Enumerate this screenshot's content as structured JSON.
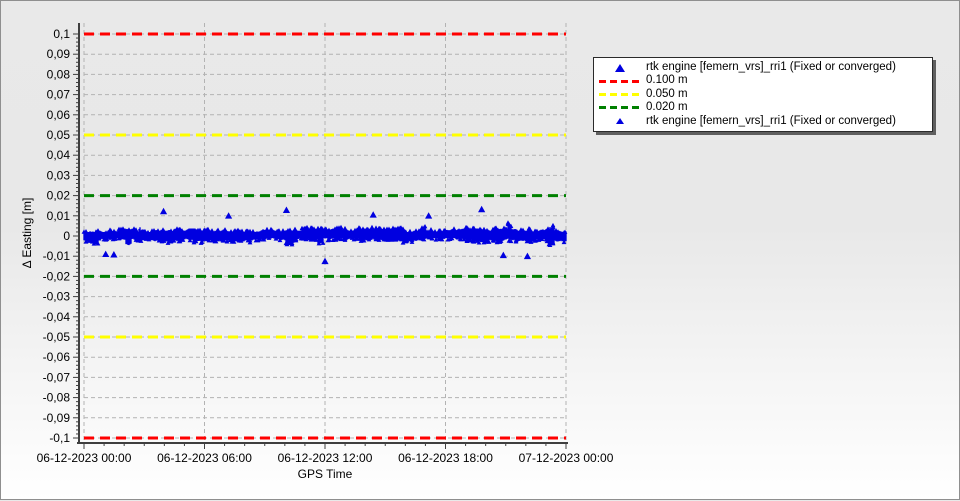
{
  "chart_data": {
    "type": "scatter",
    "title": "",
    "xlabel": "GPS Time",
    "ylabel": "Δ Easting [m]",
    "x_tick_labels": [
      "06-12-2023 00:00",
      "06-12-2023 06:00",
      "06-12-2023 12:00",
      "06-12-2023 18:00",
      "07-12-2023 00:00"
    ],
    "y_tick_labels": [
      "0,1",
      "0,09",
      "0,08",
      "0,07",
      "0,06",
      "0,05",
      "0,04",
      "0,03",
      "0,02",
      "0,01",
      "0",
      "-0,01",
      "-0,02",
      "-0,03",
      "-0,04",
      "-0,05",
      "-0,06",
      "-0,07",
      "-0,08",
      "-0,09",
      "-0,1"
    ],
    "ylim": [
      -0.1,
      0.1
    ],
    "y_major_step": 0.01,
    "decimal_separator": ",",
    "grid": {
      "show": true,
      "color": "#b3b3b3",
      "style": "dashed"
    },
    "axis_color": "#3f3f3f",
    "text_color": "#000000",
    "threshold_lines": [
      {
        "value": 0.1,
        "color": "#ff0000",
        "style": "dashed",
        "label": "0.100 m"
      },
      {
        "value": -0.1,
        "color": "#ff0000",
        "style": "dashed",
        "label": "0.100 m"
      },
      {
        "value": 0.05,
        "color": "#ffff00",
        "style": "dashed",
        "label": "0.050 m"
      },
      {
        "value": -0.05,
        "color": "#ffff00",
        "style": "dashed",
        "label": "0.050 m"
      },
      {
        "value": 0.02,
        "color": "#008000",
        "style": "dashed",
        "label": "0.020 m"
      },
      {
        "value": -0.02,
        "color": "#008000",
        "style": "dashed",
        "label": "0.020 m"
      }
    ],
    "series": [
      {
        "name": "rtk engine [femern_vrs]_rri1 (Fixed or converged)",
        "marker": "triangle",
        "color": "#0000e0",
        "time_start": "06-12-2023 00:00",
        "time_end": "07-12-2023 00:00",
        "band_center": 0.0005,
        "typical_halfwidth": 0.0025,
        "regular_excursion": 0.007,
        "noise_seed": 20231206,
        "points_per_day": 2500,
        "outliers": [
          {
            "x_frac": 0.045,
            "y": -0.009
          },
          {
            "x_frac": 0.062,
            "y": -0.0092
          },
          {
            "x_frac": 0.165,
            "y": 0.0122
          },
          {
            "x_frac": 0.3,
            "y": 0.01
          },
          {
            "x_frac": 0.42,
            "y": 0.0128
          },
          {
            "x_frac": 0.5,
            "y": -0.0125
          },
          {
            "x_frac": 0.6,
            "y": 0.0105
          },
          {
            "x_frac": 0.715,
            "y": 0.01
          },
          {
            "x_frac": 0.825,
            "y": 0.0132
          },
          {
            "x_frac": 0.87,
            "y": -0.0095
          },
          {
            "x_frac": 0.92,
            "y": -0.01
          }
        ]
      }
    ],
    "legend_position": "top-right",
    "legend": [
      {
        "marker": "triangle",
        "color": "#0000e0",
        "label": "rtk engine [femern_vrs]_rri1 (Fixed or converged)"
      },
      {
        "marker": "dashes",
        "color": "#ff0000",
        "label": "0.100 m"
      },
      {
        "marker": "dashes",
        "color": "#ffff00",
        "label": "0.050 m"
      },
      {
        "marker": "dashes",
        "color": "#008000",
        "label": "0.020 m"
      },
      {
        "marker": "triangle-small",
        "color": "#0000e0",
        "label": "rtk engine [femern_vrs]_rri1 (Fixed or converged)"
      }
    ]
  }
}
